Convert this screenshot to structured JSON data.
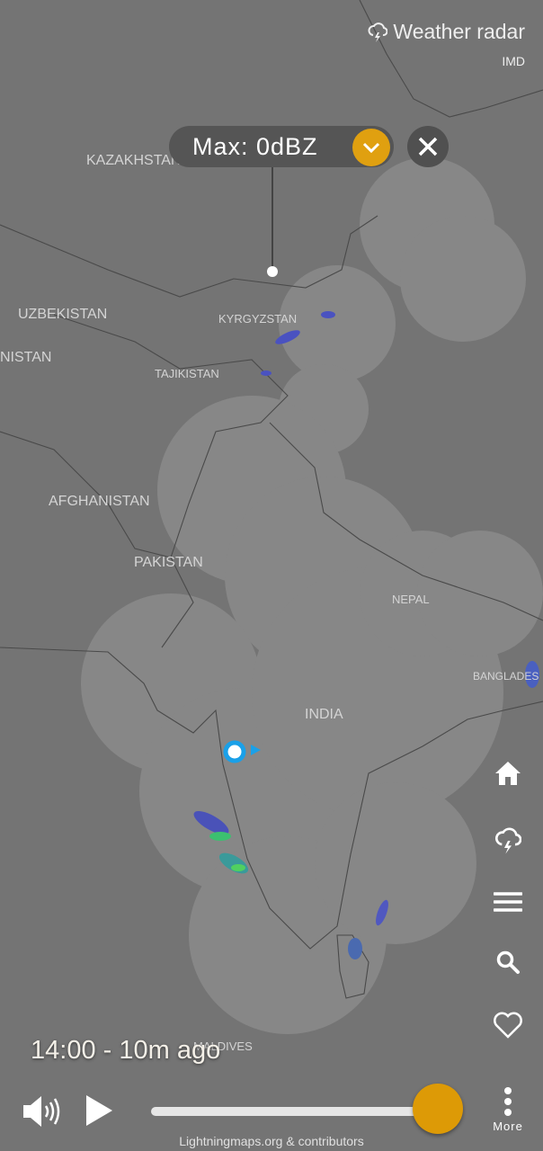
{
  "header": {
    "title": "Weather radar",
    "title_icon": "lightning-cloud-icon",
    "source": "IMD"
  },
  "marker_popup": {
    "text": "Max: 0dBZ",
    "dropdown_icon": "chevron-down-icon",
    "close_icon": "close-icon"
  },
  "map_labels": [
    "KAZAKHSTAN",
    "UZBEKISTAN",
    "KYRGYZSTAN",
    "NISTAN",
    "TAJIKISTAN",
    "AFGHANISTAN",
    "PAKISTAN",
    "NEPAL",
    "INDIA",
    "BANGLADES",
    "MALDIVES"
  ],
  "side_buttons": [
    "home-icon",
    "lightning-cloud-icon",
    "menu-icon",
    "search-icon",
    "heart-icon"
  ],
  "playback": {
    "time": "14:00 - 10m ago",
    "progress_percent": 100,
    "more_label": "More"
  },
  "attribution": "Lightningmaps.org & contributors",
  "colors": {
    "accent": "#dd9a06",
    "background": "#747474",
    "radar_coverage": "#8a8a8a"
  }
}
